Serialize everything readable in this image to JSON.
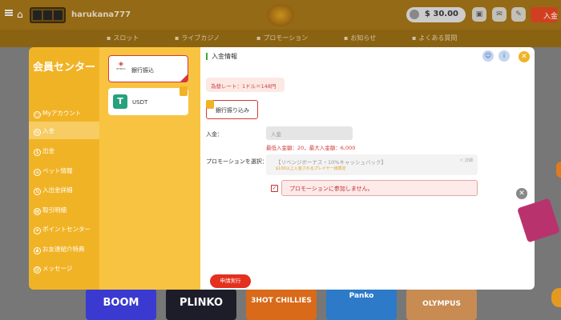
{
  "header": {
    "username": "harukana777",
    "balance": "$ 30.00",
    "login_label": "入金"
  },
  "nav": [
    "スロット",
    "ライブカジノ",
    "プロモーション",
    "お知らせ",
    "よくある質問"
  ],
  "sidebar": {
    "title": "会員センター",
    "items": [
      {
        "label": "Myアカウント"
      },
      {
        "label": "入金"
      },
      {
        "label": "出金"
      },
      {
        "label": "ベット情報"
      },
      {
        "label": "入出金詳細"
      },
      {
        "label": "取引明細"
      },
      {
        "label": "ポイントセンター"
      },
      {
        "label": "お友達紹介特典"
      },
      {
        "label": "メッセージ"
      }
    ]
  },
  "methods": [
    {
      "label": "銀行振込",
      "logo": "BITBUG"
    },
    {
      "label": "USDT"
    }
  ],
  "main": {
    "section_title": "入金情報",
    "rate": "為替レート：1ドル＝148円",
    "bank_button": "銀行振り込み",
    "amount_label": "入金：",
    "amount_placeholder": "入金",
    "minmax": "最低入金額：20，最大入金額：6,000",
    "promo_label": "プロモーションを選択：",
    "promo_title": "【リベンジボーナス・10%キャッシュバック】",
    "promo_sub": "$100以上入金されるプレイヤー様限定",
    "promo_side": "＜ 詳細",
    "promo_none": "プロモーションに参加しません。",
    "apply_button": "申請実行"
  },
  "games": [
    "BOOM",
    "PLINKO",
    "3HOT CHILLIES",
    "Panko",
    "OLYMPUS"
  ]
}
